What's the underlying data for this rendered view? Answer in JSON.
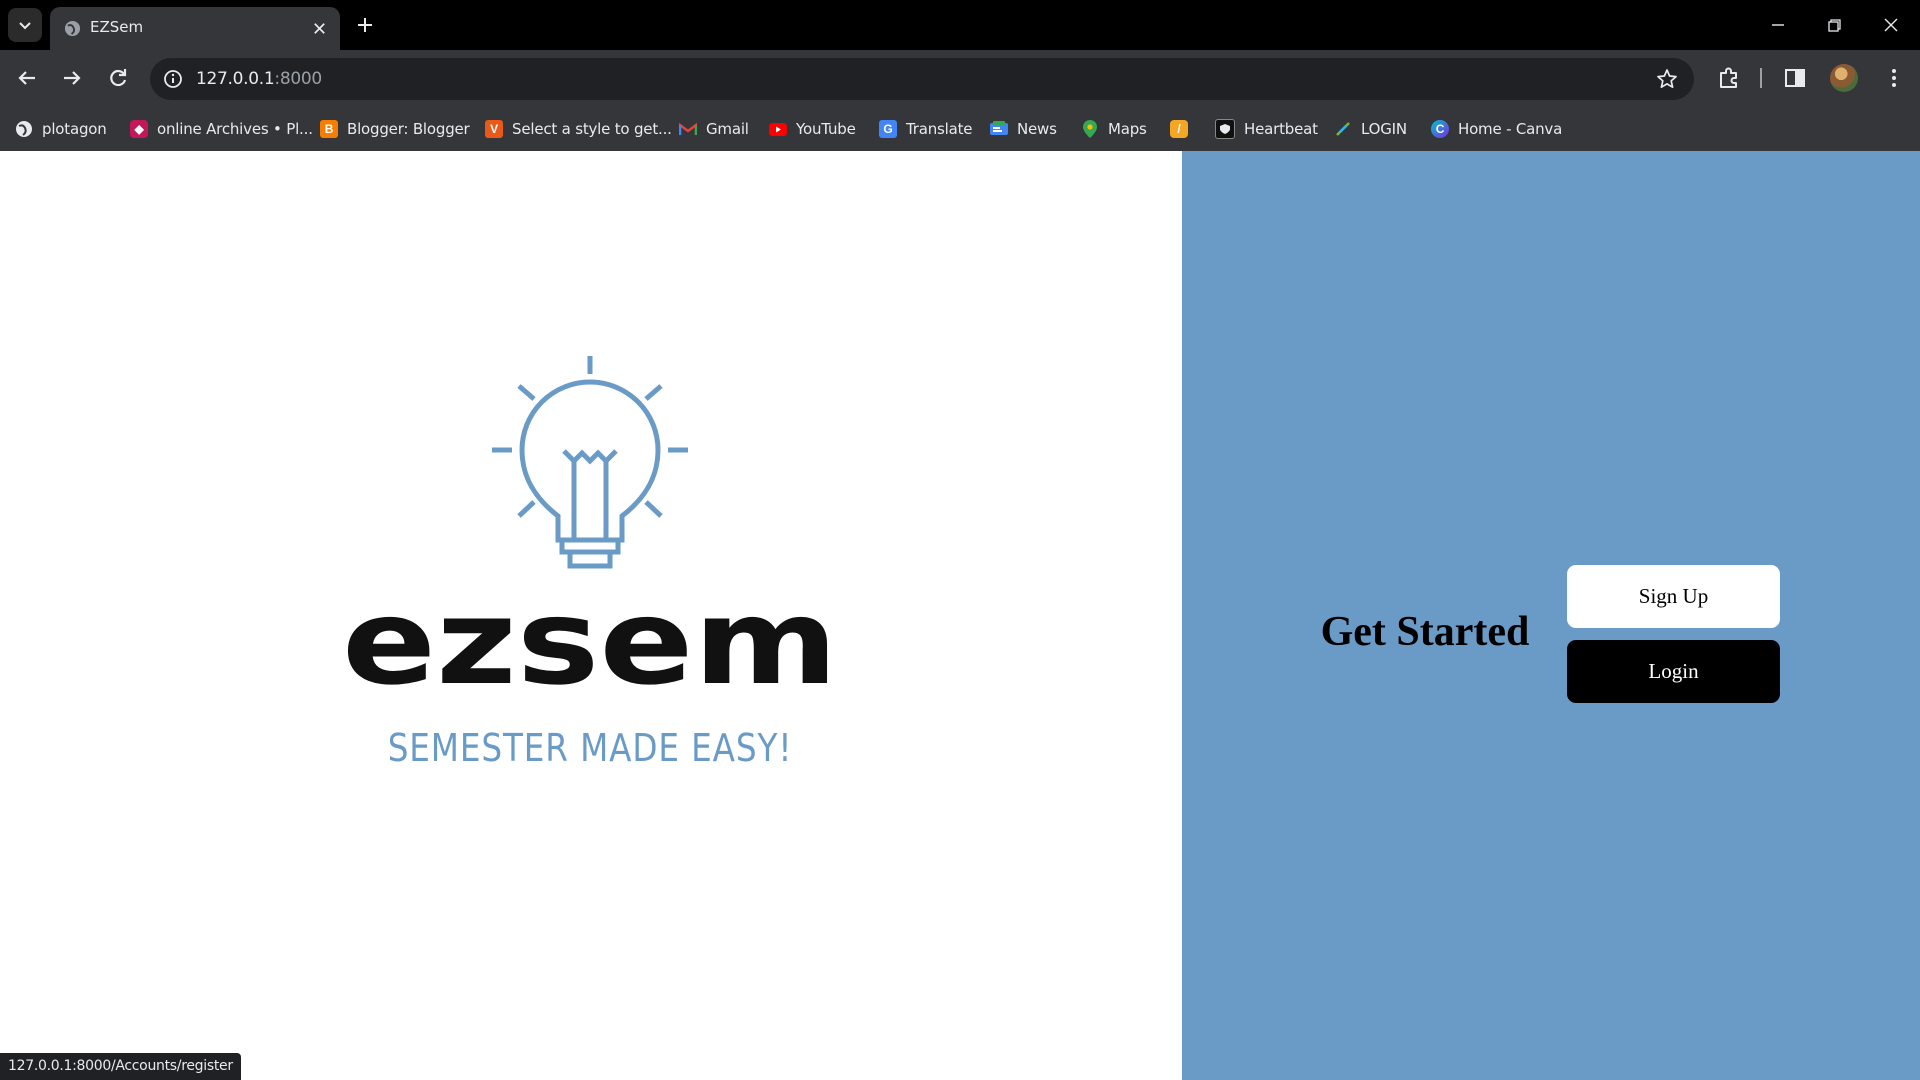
{
  "browser": {
    "tab": {
      "title": "EZSem"
    },
    "address": {
      "host": "127.0.0.1",
      "port": ":8000"
    },
    "status_url": "127.0.0.1:8000/Accounts/register",
    "bookmarks": [
      {
        "label": "plotagon",
        "icon": "globe-icon"
      },
      {
        "label": "online Archives • Pl...",
        "icon": "archive-favicon-icon"
      },
      {
        "label": "Blogger: Blogger",
        "icon": "blogger-icon"
      },
      {
        "label": "Select a style to get...",
        "icon": "v-logo-icon"
      },
      {
        "label": "Gmail",
        "icon": "gmail-icon"
      },
      {
        "label": "YouTube",
        "icon": "youtube-icon"
      },
      {
        "label": "Translate",
        "icon": "translate-icon"
      },
      {
        "label": "News",
        "icon": "news-icon"
      },
      {
        "label": "Maps",
        "icon": "maps-icon"
      },
      {
        "label": "",
        "icon": "orange-app-icon"
      },
      {
        "label": "Heartbeat",
        "icon": "shield-icon"
      },
      {
        "label": "LOGIN",
        "icon": "link-icon"
      },
      {
        "label": "Home - Canva",
        "icon": "canva-icon"
      }
    ]
  },
  "page": {
    "logo": {
      "wordmark": "ezsem",
      "tagline": "SEMESTER MADE EASY!"
    },
    "heading": "Get Started",
    "signup_label": "Sign Up",
    "login_label": "Login"
  },
  "colors": {
    "accent_blue": "#6a9bc7",
    "chrome_dark": "#35363a",
    "omnibox": "#202124"
  }
}
